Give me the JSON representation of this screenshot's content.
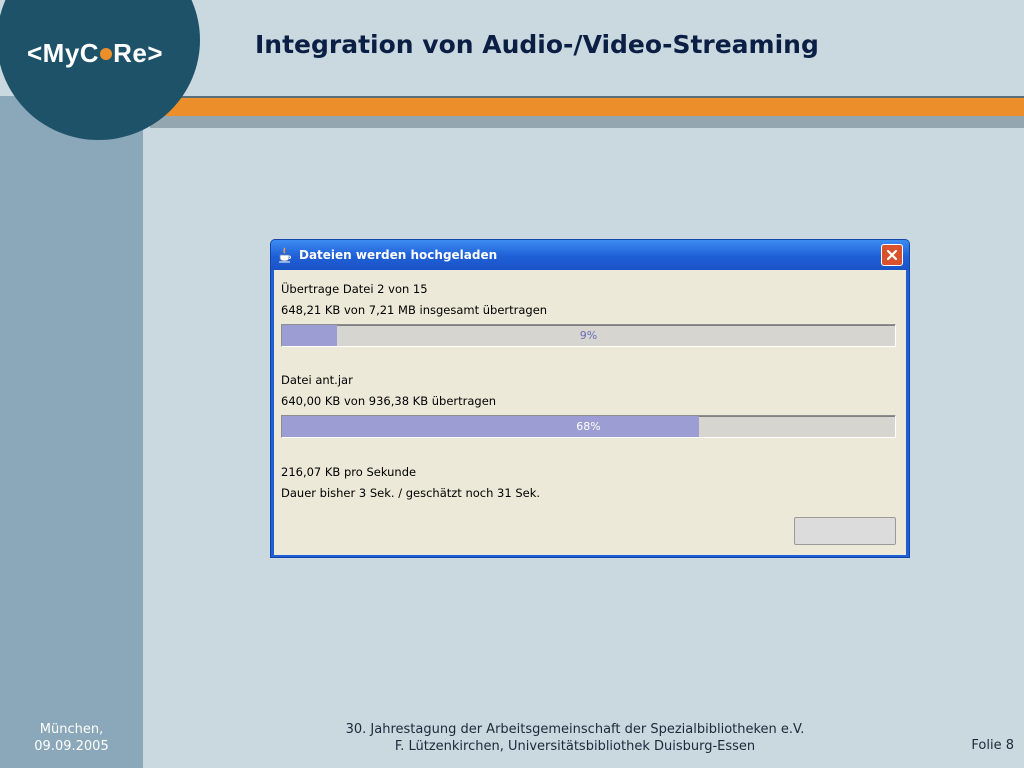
{
  "slide": {
    "logo_parts": [
      "<MyC",
      "Re>"
    ],
    "title": "Integration von Audio-/Video-Streaming"
  },
  "dialog": {
    "title": "Dateien werden hochgeladen",
    "line1": "Übertrage Datei 2 von 15",
    "line2": "648,21 KB von 7,21 MB insgesamt übertragen",
    "progress1": {
      "label": "9%",
      "value": 0.09
    },
    "line3": "Datei ant.jar",
    "line4": "640,00 KB von 936,38 KB übertragen",
    "progress2": {
      "label": "68%",
      "value": 0.68
    },
    "line5": "216,07 KB pro Sekunde",
    "line6": "Dauer bisher 3 Sek. / geschätzt noch 31 Sek."
  },
  "footer": {
    "left_line1": "München,",
    "left_line2": "09.09.2005",
    "center_line1": "30. Jahrestagung der Arbeitsgemeinschaft der Spezialbibliotheken e.V.",
    "center_line2": "F. Lützenkirchen, Universitätsbibliothek Duisburg-Essen",
    "right": "Folie 8"
  },
  "colors": {
    "orange_accent": "#ec8f2b",
    "logo_blue": "#1d5269",
    "title_navy": "#0b1f45",
    "progress_fill": "#9c9ed3",
    "xp_titlebar_blue": "#1f5fd6"
  },
  "icons": {
    "title_icon": "java-cup-icon",
    "close": "close-icon"
  }
}
